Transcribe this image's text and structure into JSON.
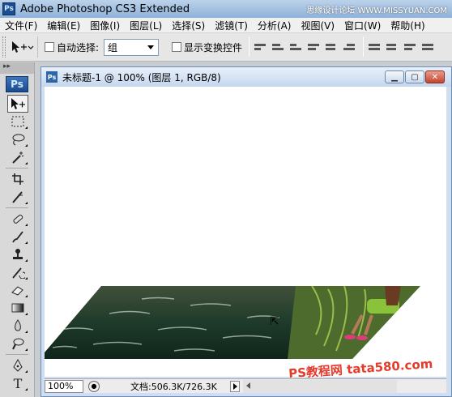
{
  "app": {
    "icon_label": "Ps",
    "title": "Adobe Photoshop CS3 Extended",
    "watermark_top": "思缘设计论坛 WWW.MISSYUAN.COM"
  },
  "menu": [
    "文件(F)",
    "编辑(E)",
    "图像(I)",
    "图层(L)",
    "选择(S)",
    "滤镜(T)",
    "分析(A)",
    "视图(V)",
    "窗口(W)",
    "帮助(H)"
  ],
  "options": {
    "auto_select_label": "自动选择:",
    "auto_select_value": "组",
    "show_transform_label": "显示变换控件"
  },
  "toolbox": {
    "logo": "Ps",
    "tools": [
      "move-tool",
      "marquee-tool",
      "lasso-tool",
      "magic-wand-tool",
      "crop-tool",
      "slice-tool",
      "healing-brush-tool",
      "brush-tool",
      "clone-stamp-tool",
      "history-brush-tool",
      "eraser-tool",
      "gradient-tool",
      "blur-tool",
      "dodge-tool",
      "pen-tool",
      "type-tool"
    ]
  },
  "document": {
    "icon_label": "Ps",
    "title": "未标题-1 @ 100% (图层 1, RGB/8)",
    "zoom": "100%",
    "doc_size": "文档:506.3K/726.3K"
  },
  "watermark_bottom": "PS教程网 tata580.com",
  "colors": {
    "titlebar": "#9ebcde",
    "water": "#1f3a27",
    "grass": "#6a8e2a",
    "accent_red": "#e43b2b"
  }
}
